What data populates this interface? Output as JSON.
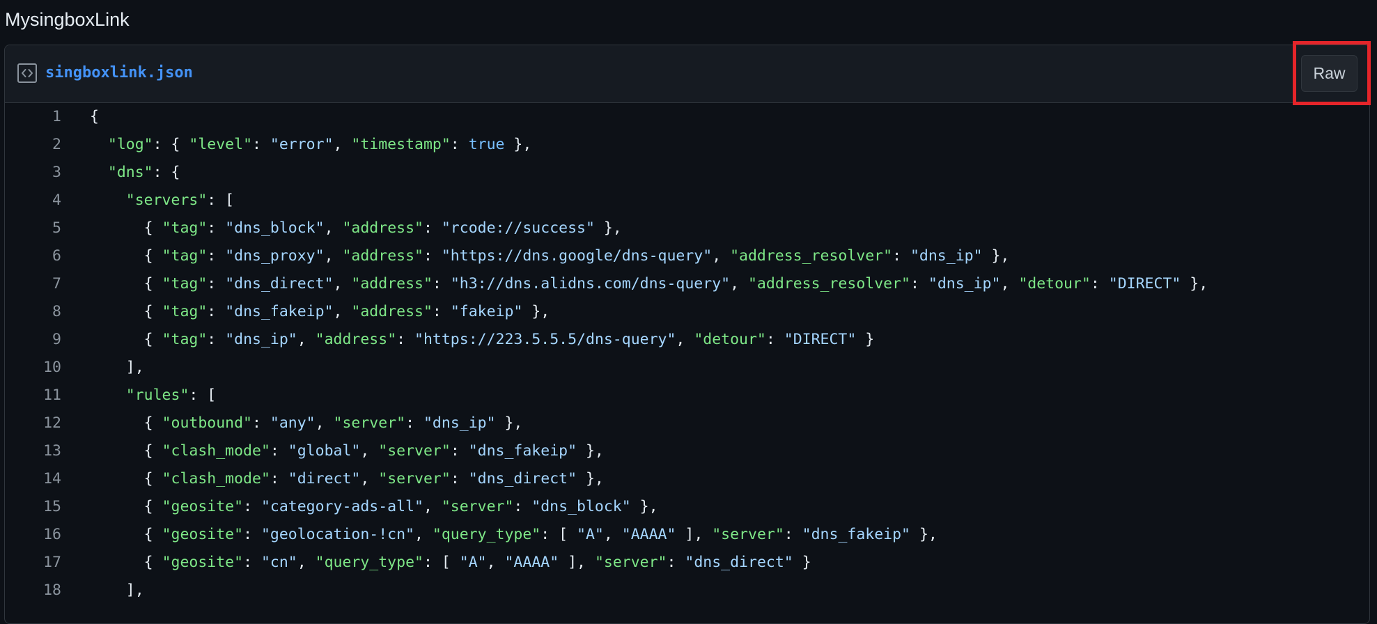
{
  "page": {
    "title": "MysingboxLink"
  },
  "file": {
    "icon": "code-file-icon",
    "name": "singboxlink.json",
    "raw_label": "Raw",
    "highlight_color": "#e5252a"
  },
  "colors": {
    "background": "#0d1117",
    "header": "#161b22",
    "border": "#30363d",
    "file_link": "#4493f8",
    "json_key": "#7ee787",
    "json_string": "#a5d6ff",
    "json_keyword": "#79c0ff",
    "line_number": "#8b949e",
    "punctuation": "#e6edf3"
  },
  "code_lines": [
    {
      "n": "1",
      "text": "{"
    },
    {
      "n": "2",
      "text": "  \"log\": { \"level\": \"error\", \"timestamp\": true },"
    },
    {
      "n": "3",
      "text": "  \"dns\": {"
    },
    {
      "n": "4",
      "text": "    \"servers\": ["
    },
    {
      "n": "5",
      "text": "      { \"tag\": \"dns_block\", \"address\": \"rcode://success\" },"
    },
    {
      "n": "6",
      "text": "      { \"tag\": \"dns_proxy\", \"address\": \"https://dns.google/dns-query\", \"address_resolver\": \"dns_ip\" },"
    },
    {
      "n": "7",
      "text": "      { \"tag\": \"dns_direct\", \"address\": \"h3://dns.alidns.com/dns-query\", \"address_resolver\": \"dns_ip\", \"detour\": \"DIRECT\" },"
    },
    {
      "n": "8",
      "text": "      { \"tag\": \"dns_fakeip\", \"address\": \"fakeip\" },"
    },
    {
      "n": "9",
      "text": "      { \"tag\": \"dns_ip\", \"address\": \"https://223.5.5.5/dns-query\", \"detour\": \"DIRECT\" }"
    },
    {
      "n": "10",
      "text": "    ],"
    },
    {
      "n": "11",
      "text": "    \"rules\": ["
    },
    {
      "n": "12",
      "text": "      { \"outbound\": \"any\", \"server\": \"dns_ip\" },"
    },
    {
      "n": "13",
      "text": "      { \"clash_mode\": \"global\", \"server\": \"dns_fakeip\" },"
    },
    {
      "n": "14",
      "text": "      { \"clash_mode\": \"direct\", \"server\": \"dns_direct\" },"
    },
    {
      "n": "15",
      "text": "      { \"geosite\": \"category-ads-all\", \"server\": \"dns_block\" },"
    },
    {
      "n": "16",
      "text": "      { \"geosite\": \"geolocation-!cn\", \"query_type\": [ \"A\", \"AAAA\" ], \"server\": \"dns_fakeip\" },"
    },
    {
      "n": "17",
      "text": "      { \"geosite\": \"cn\", \"query_type\": [ \"A\", \"AAAA\" ], \"server\": \"dns_direct\" }"
    },
    {
      "n": "18",
      "text": "    ],"
    }
  ]
}
